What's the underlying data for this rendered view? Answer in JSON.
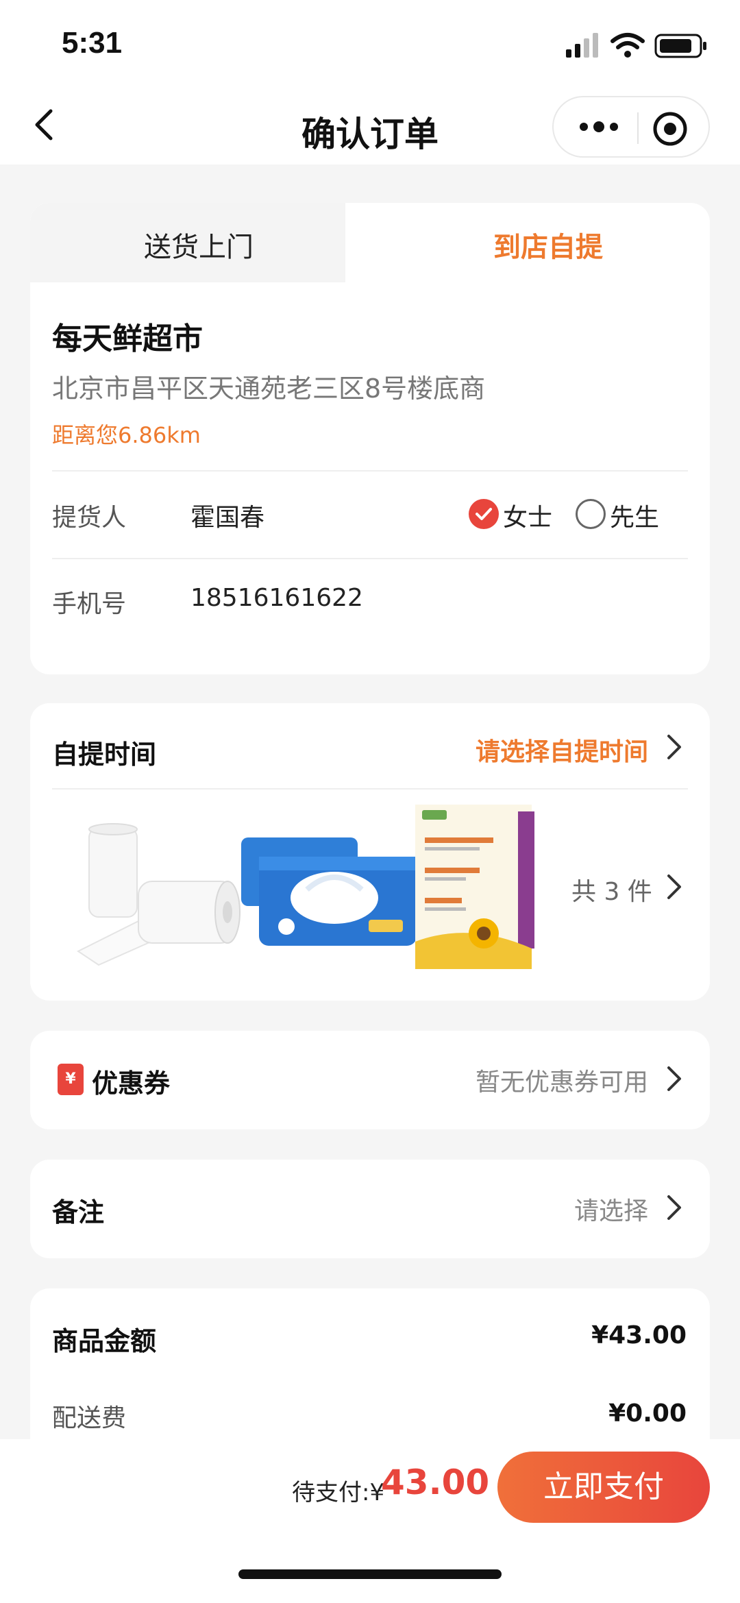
{
  "status_bar": {
    "time": "5:31"
  },
  "nav": {
    "title": "确认订单"
  },
  "tabs": [
    {
      "label": "送货上门",
      "active": false
    },
    {
      "label": "到店自提",
      "active": true
    }
  ],
  "store": {
    "name": "每天鲜超市",
    "address": "北京市昌平区天通苑老三区8号楼底商",
    "distance": "距离您6.86km"
  },
  "pickup": {
    "person_label": "提货人",
    "person_value": "霍国春",
    "gender_options": [
      {
        "label": "女士",
        "checked": true
      },
      {
        "label": "先生",
        "checked": false
      }
    ],
    "phone_label": "手机号",
    "phone_value": "18516161622"
  },
  "pickup_time": {
    "title": "自提时间",
    "action": "请选择自提时间",
    "products": [
      {
        "icon": "paper-towel-roll"
      },
      {
        "icon": "wet-wipes-pack"
      },
      {
        "icon": "sunflower-oil-box"
      }
    ],
    "count_text": "共 3 件"
  },
  "coupon": {
    "title": "优惠券",
    "icon_text": "¥",
    "value": "暂无优惠券可用"
  },
  "remark": {
    "title": "备注",
    "value": "请选择"
  },
  "amounts": {
    "goods_label": "商品金额",
    "goods_value": "¥43.00",
    "delivery_label": "配送费",
    "delivery_value": "¥0.00"
  },
  "bottom": {
    "pay_label": "待支付:¥",
    "pay_amount": "43.00",
    "pay_button": "立即支付"
  },
  "colors": {
    "accent": "#ee7a2e",
    "red": "#e8453c"
  }
}
